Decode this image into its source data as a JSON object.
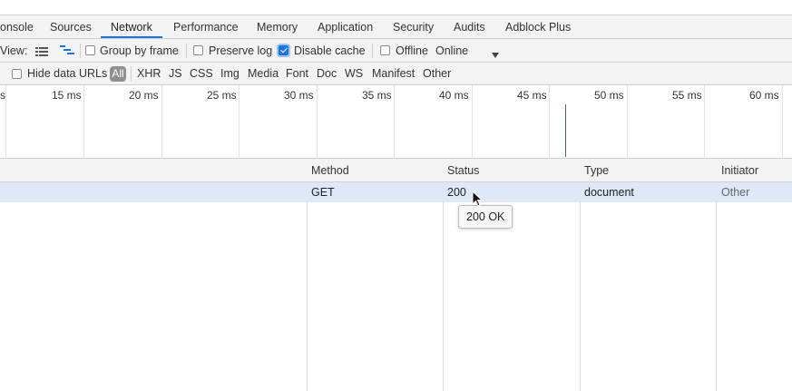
{
  "tabs": [
    {
      "label": "onsole"
    },
    {
      "label": "Sources"
    },
    {
      "label": "Network",
      "active": true
    },
    {
      "label": "Performance"
    },
    {
      "label": "Memory"
    },
    {
      "label": "Application"
    },
    {
      "label": "Security"
    },
    {
      "label": "Audits"
    },
    {
      "label": "Adblock Plus"
    }
  ],
  "toolbar": {
    "view_label": "View:",
    "group_by_frame": {
      "label": "Group by frame",
      "checked": false
    },
    "preserve_log": {
      "label": "Preserve log",
      "checked": false
    },
    "disable_cache": {
      "label": "Disable cache",
      "checked": true
    },
    "offline": {
      "label": "Offline",
      "checked": false
    },
    "throttle": {
      "value": "Online"
    }
  },
  "filter": {
    "hide_data_urls": {
      "label": "Hide data URLs",
      "checked": false
    },
    "types": [
      "All",
      "XHR",
      "JS",
      "CSS",
      "Img",
      "Media",
      "Font",
      "Doc",
      "WS",
      "Manifest",
      "Other"
    ],
    "active_type": "All"
  },
  "timeline": {
    "ticks": [
      "15 ms",
      "20 ms",
      "25 ms",
      "30 ms",
      "35 ms",
      "40 ms",
      "45 ms",
      "50 ms",
      "55 ms",
      "60 ms"
    ],
    "partial_tick": "s"
  },
  "table": {
    "columns": [
      "Method",
      "Status",
      "Type",
      "Initiator"
    ],
    "rows": [
      {
        "method": "GET",
        "status": "200",
        "type": "document",
        "initiator": "Other"
      }
    ]
  },
  "tooltip": {
    "text": "200 OK"
  },
  "colors": {
    "accent": "#1a73e8",
    "selected_row": "#dde8f8",
    "toolbar_bg": "#f3f3f3"
  }
}
